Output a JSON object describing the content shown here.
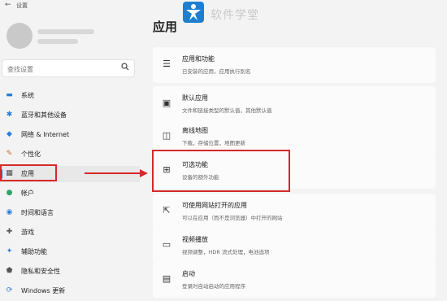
{
  "window": {
    "title": "设置",
    "back_glyph": "←"
  },
  "watermark": {
    "text": "软件学堂"
  },
  "search": {
    "placeholder": "查找设置",
    "icon": "search-icon"
  },
  "sidebar": {
    "items": [
      {
        "label": "系统",
        "icon": "monitor-icon",
        "glyph": "▬",
        "color": "#2b7cd3"
      },
      {
        "label": "蓝牙和其他设备",
        "icon": "bluetooth-icon",
        "glyph": "✱",
        "color": "#2b7cd3"
      },
      {
        "label": "网络 & Internet",
        "icon": "network-icon",
        "glyph": "◆",
        "color": "#2b7cd3"
      },
      {
        "label": "个性化",
        "icon": "pencil-icon",
        "glyph": "✎",
        "color": "#c26a2a"
      },
      {
        "label": "应用",
        "icon": "apps-icon",
        "glyph": "▦",
        "color": "#4b4b4b",
        "selected": true
      },
      {
        "label": "帐户",
        "icon": "account-icon",
        "glyph": "●",
        "color": "#2ea36a"
      },
      {
        "label": "时间和语言",
        "icon": "globe-clock-icon",
        "glyph": "◉",
        "color": "#2b7cd3"
      },
      {
        "label": "游戏",
        "icon": "gamepad-icon",
        "glyph": "✚",
        "color": "#555555"
      },
      {
        "label": "辅助功能",
        "icon": "accessibility-icon",
        "glyph": "✦",
        "color": "#2b7cd3"
      },
      {
        "label": "隐私和安全性",
        "icon": "shield-icon",
        "glyph": "⬟",
        "color": "#555555"
      },
      {
        "label": "Windows 更新",
        "icon": "windows-update-icon",
        "glyph": "⟳",
        "color": "#2b7cd3"
      }
    ]
  },
  "main": {
    "title": "应用",
    "cards": [
      {
        "title": "应用和功能",
        "subtitle": "已安装的应用，应用执行别名",
        "icon": "apps-list-icon",
        "glyph": "☰"
      },
      {
        "title": "默认应用",
        "subtitle": "文件和链接类型的默认值，其他默认值",
        "icon": "default-apps-icon",
        "glyph": "▣"
      },
      {
        "title": "离线地图",
        "subtitle": "下载，存储位置，地图更新",
        "icon": "map-icon",
        "glyph": "◫"
      },
      {
        "title": "可选功能",
        "subtitle": "设备的额外功能",
        "icon": "optional-features-icon",
        "glyph": "⊞"
      },
      {
        "title": "可使用网站打开的应用",
        "subtitle": "可以在应用（而不是浏览器）中打开的网站",
        "icon": "open-with-icon",
        "glyph": "⇱"
      },
      {
        "title": "视频播放",
        "subtitle": "视频调整，HDR 流式处理，电池选项",
        "icon": "video-icon",
        "glyph": "▭"
      },
      {
        "title": "启动",
        "subtitle": "登录时自动启动的应用程序",
        "icon": "startup-icon",
        "glyph": "▤"
      }
    ]
  },
  "annotation": {
    "color": "#d42a2a"
  }
}
